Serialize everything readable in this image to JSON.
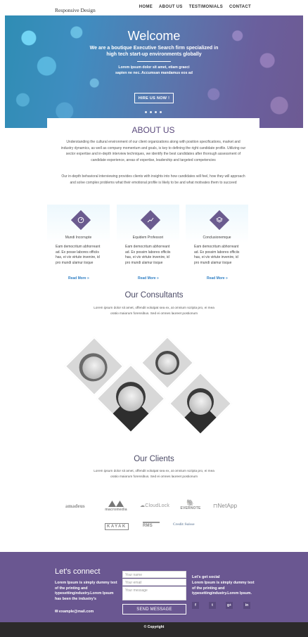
{
  "header": {
    "logo": "Responsive Design",
    "nav": [
      "HOME",
      "ABOUT US",
      "TESTIMONIALS",
      "CONTACT"
    ]
  },
  "hero": {
    "title": "Welcome",
    "subtitle": "We are a boutique Executive Search firm specialized in high tech start-up environments globally",
    "text": "Lorem ipsum dolor sit amet, etiam graeci sapien ne nec. Accumsan mandamus eos ad",
    "button": "HIRE US NOW !"
  },
  "about": {
    "title": "ABOUT US",
    "p1": "Understanding the cultural environment of our client organizations along with position specifications, market and industry dynamics, as well as company momentum and goals, is key to defining the right candidate profile. Utilizing our sector expertise and in-depth interview techniques, we identify the best candidates after thorough assessment of candidate experience, areas of expertise, leadership and targeted competencies",
    "p2": "Our in-depth behavioral interviewing provides clients with insights into how candidates will feel, how they will approach and solve complex problems what their emotional profile is likely to be and what motivates them to succeed"
  },
  "features": [
    {
      "title": "Mundi Incorrupte",
      "text": "Eam democritum abhorreant ad. Ex posse labores officiis has, ei vix virtute invenire, id pro mundi ulamur iisque",
      "link": "Read More »",
      "icon": "gauge-icon"
    },
    {
      "title": "Equidem Professori",
      "text": "Eam democritum abhorreant ad. Ex possim labores officiis has, ei vix virtute invenire, id pro mundi ulamur iisque",
      "link": "Read More »",
      "icon": "chart-icon"
    },
    {
      "title": "Conclusionemque",
      "text": "Eam democritum abhorreant ad. Ex possim labores officiis has, ei vix virtute invenire, id pro mundi ulamur iisque",
      "link": "Read More »",
      "icon": "layers-icon"
    }
  ],
  "consultants": {
    "title": "Our Consultants",
    "text": "Lorem ipsum dolor sit amet, offendit volutpat sea ex, at omnium scripta pro, ei mea oratio maiorum forensibus. Sed ei omnes laoreet postionum"
  },
  "clients": {
    "title": "Our Clients",
    "text": "Lorem ipsum dolor sit amet, offendit volutpat sea ex, at omnium scripta pro, ei mea oratio maiorum forensibus. Sed ei omnes laoreet postionum",
    "logos": [
      "amadeus",
      "macromedia",
      "CloudLock",
      "EVERNOTE",
      "NetApp",
      "KAYAK",
      "RMS",
      "Credit Suisse"
    ]
  },
  "footer": {
    "connect_title": "Let's connect",
    "connect_text": "Lorem Ipsum is simply dummy text of the printing and typesettingindustry.Lorem Ipsum has been the industry's",
    "email": "example@mail.com",
    "name_placeholder": "Your name",
    "email_placeholder": "Your email",
    "message_placeholder": "Your message",
    "send_button": "SEND MESSAGE",
    "social_title": "Let's get social",
    "social_text": "Lorem Ipsum is simply dummy text of the printing and typesettingindustry.Lorem Ipsum.",
    "social": [
      "f",
      "t",
      "g+",
      "in"
    ],
    "copyright": "© Copyright"
  },
  "colors": {
    "brand_purple": "#6a5791",
    "link_blue": "#2f7fc4",
    "footer_dark": "#2c2a2b"
  }
}
